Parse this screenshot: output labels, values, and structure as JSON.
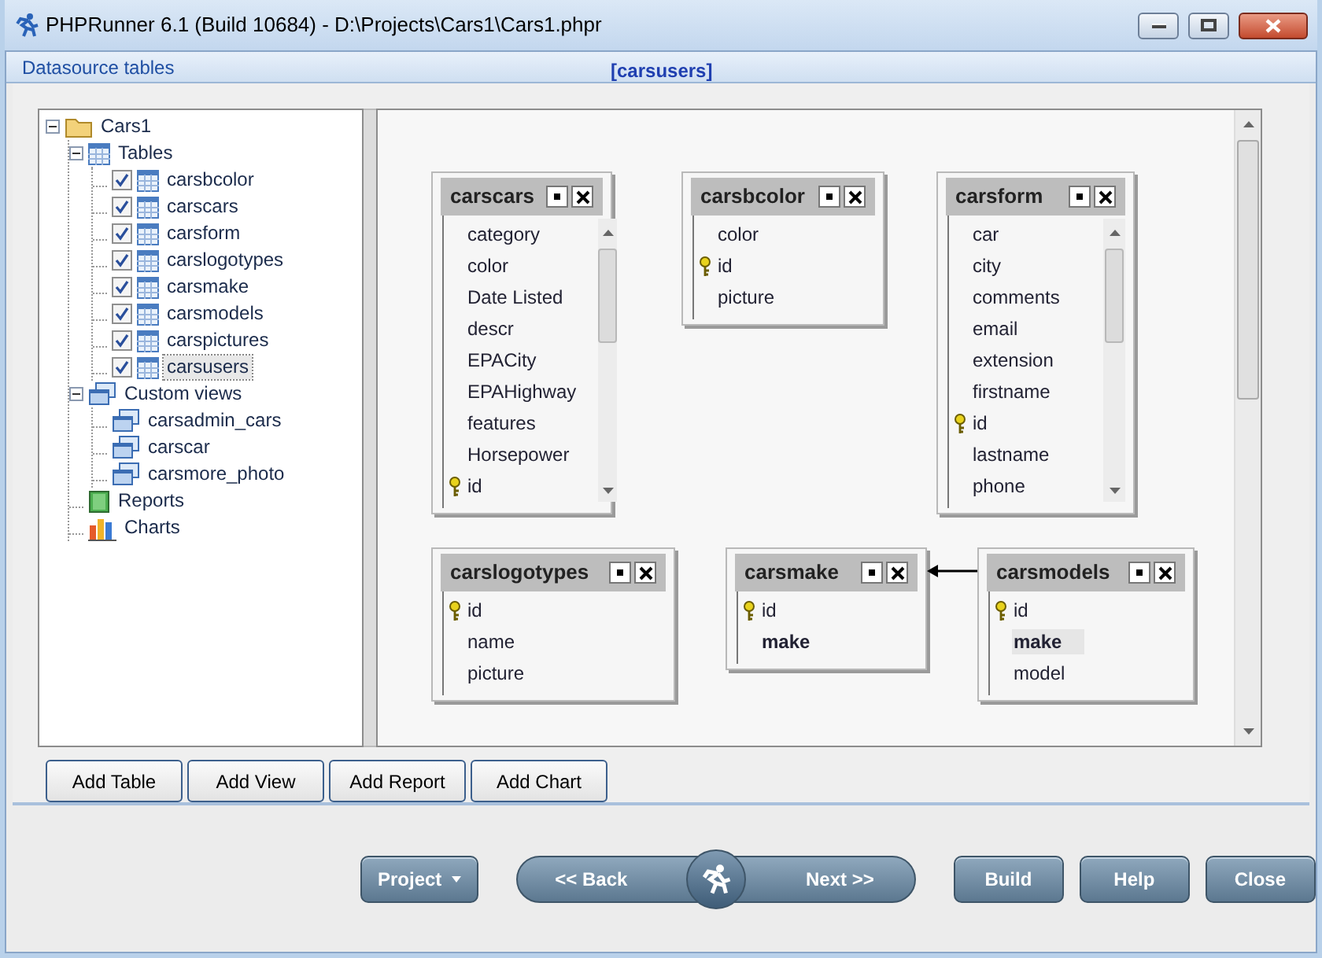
{
  "window": {
    "title": "PHPRunner 6.1 (Build 10684) - D:\\Projects\\Cars1\\Cars1.phpr"
  },
  "header": {
    "left": "Datasource tables",
    "center": "[carsusers]"
  },
  "tree": [
    {
      "label": "Cars1",
      "kind": "folder",
      "expanded": true,
      "selected": false,
      "children": [
        {
          "label": "Tables",
          "kind": "tables",
          "expanded": true,
          "selected": false,
          "children": [
            {
              "label": "carsbcolor",
              "kind": "table",
              "checked": true,
              "selected": false
            },
            {
              "label": "carscars",
              "kind": "table",
              "checked": true,
              "selected": false
            },
            {
              "label": "carsform",
              "kind": "table",
              "checked": true,
              "selected": false
            },
            {
              "label": "carslogotypes",
              "kind": "table",
              "checked": true,
              "selected": false
            },
            {
              "label": "carsmake",
              "kind": "table",
              "checked": true,
              "selected": false
            },
            {
              "label": "carsmodels",
              "kind": "table",
              "checked": true,
              "selected": false
            },
            {
              "label": "carspictures",
              "kind": "table",
              "checked": true,
              "selected": false
            },
            {
              "label": "carsusers",
              "kind": "table",
              "checked": true,
              "selected": true
            }
          ]
        },
        {
          "label": "Custom views",
          "kind": "views",
          "expanded": true,
          "selected": false,
          "children": [
            {
              "label": "carsadmin_cars",
              "kind": "view",
              "selected": false
            },
            {
              "label": "carscar",
              "kind": "view",
              "selected": false
            },
            {
              "label": "carsmore_photo",
              "kind": "view",
              "selected": false
            }
          ]
        },
        {
          "label": "Reports",
          "kind": "report",
          "selected": false
        },
        {
          "label": "Charts",
          "kind": "chart",
          "selected": false
        }
      ]
    }
  ],
  "diagram_tables": [
    {
      "name": "carscars",
      "fields": [
        {
          "name": "category",
          "key": false,
          "bold": false,
          "highlighted": false
        },
        {
          "name": "color",
          "key": false,
          "bold": false,
          "highlighted": false
        },
        {
          "name": "Date Listed",
          "key": false,
          "bold": false,
          "highlighted": false
        },
        {
          "name": "descr",
          "key": false,
          "bold": false,
          "highlighted": false
        },
        {
          "name": "EPACity",
          "key": false,
          "bold": false,
          "highlighted": false
        },
        {
          "name": "EPAHighway",
          "key": false,
          "bold": false,
          "highlighted": false
        },
        {
          "name": "features",
          "key": false,
          "bold": false,
          "highlighted": false
        },
        {
          "name": "Horsepower",
          "key": false,
          "bold": false,
          "highlighted": false
        },
        {
          "name": "id",
          "key": true,
          "bold": false,
          "highlighted": false
        }
      ]
    },
    {
      "name": "carsbcolor",
      "fields": [
        {
          "name": "color",
          "key": false,
          "bold": false,
          "highlighted": false
        },
        {
          "name": "id",
          "key": true,
          "bold": false,
          "highlighted": false
        },
        {
          "name": "picture",
          "key": false,
          "bold": false,
          "highlighted": false
        }
      ]
    },
    {
      "name": "carsform",
      "fields": [
        {
          "name": "car",
          "key": false,
          "bold": false,
          "highlighted": false
        },
        {
          "name": "city",
          "key": false,
          "bold": false,
          "highlighted": false
        },
        {
          "name": "comments",
          "key": false,
          "bold": false,
          "highlighted": false
        },
        {
          "name": "email",
          "key": false,
          "bold": false,
          "highlighted": false
        },
        {
          "name": "extension",
          "key": false,
          "bold": false,
          "highlighted": false
        },
        {
          "name": "firstname",
          "key": false,
          "bold": false,
          "highlighted": false
        },
        {
          "name": "id",
          "key": true,
          "bold": false,
          "highlighted": false
        },
        {
          "name": "lastname",
          "key": false,
          "bold": false,
          "highlighted": false
        },
        {
          "name": "phone",
          "key": false,
          "bold": false,
          "highlighted": false
        }
      ]
    },
    {
      "name": "carslogotypes",
      "fields": [
        {
          "name": "id",
          "key": true,
          "bold": false,
          "highlighted": false
        },
        {
          "name": "name",
          "key": false,
          "bold": false,
          "highlighted": false
        },
        {
          "name": "picture",
          "key": false,
          "bold": false,
          "highlighted": false
        }
      ]
    },
    {
      "name": "carsmake",
      "fields": [
        {
          "name": "id",
          "key": true,
          "bold": false,
          "highlighted": false
        },
        {
          "name": "make",
          "key": false,
          "bold": true,
          "highlighted": false
        }
      ]
    },
    {
      "name": "carsmodels",
      "fields": [
        {
          "name": "id",
          "key": true,
          "bold": false,
          "highlighted": false
        },
        {
          "name": "make",
          "key": false,
          "bold": true,
          "highlighted": true
        },
        {
          "name": "model",
          "key": false,
          "bold": false,
          "highlighted": false
        }
      ]
    }
  ],
  "add_buttons": [
    "Add Table",
    "Add View",
    "Add Report",
    "Add Chart"
  ],
  "nav": {
    "project": "Project",
    "back": "<< Back",
    "next": "Next >>",
    "build": "Build",
    "help": "Help",
    "close": "Close"
  }
}
